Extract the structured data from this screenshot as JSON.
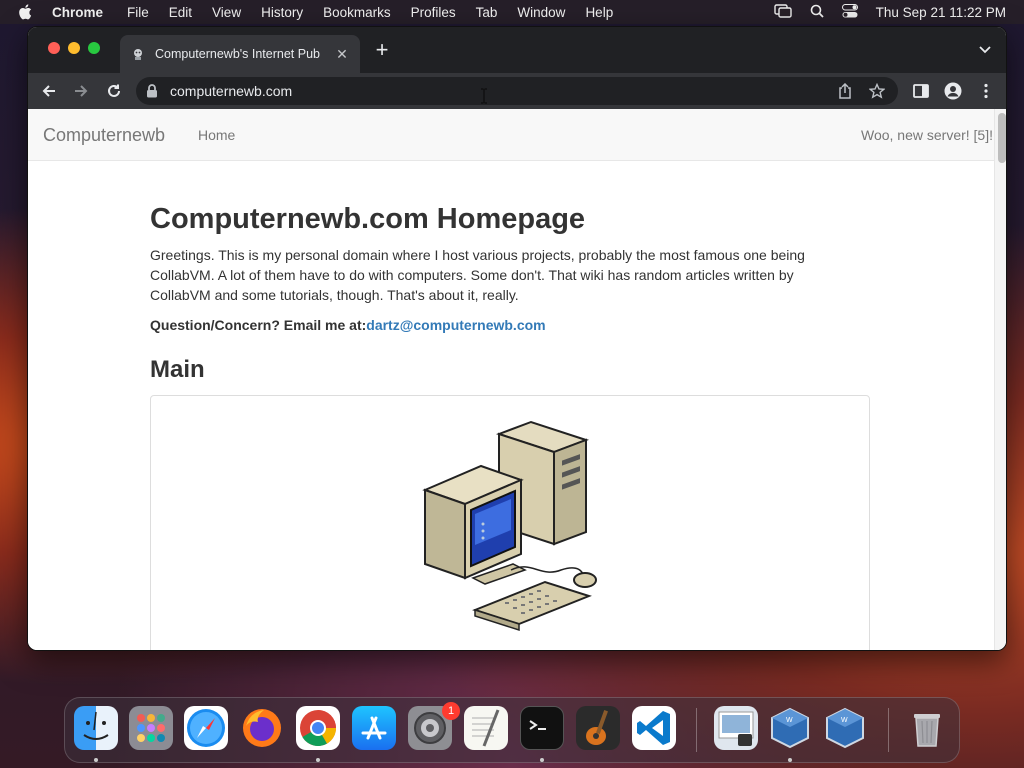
{
  "menubar": {
    "app_name": "Chrome",
    "items": [
      "File",
      "Edit",
      "View",
      "History",
      "Bookmarks",
      "Profiles",
      "Tab",
      "Window",
      "Help"
    ],
    "clock": "Thu Sep 21  11:22 PM"
  },
  "browser": {
    "tab_title": "Computernewb's Internet Pub",
    "url": "computernewb.com"
  },
  "site": {
    "brand": "Computernewb",
    "nav_home": "Home",
    "nav_right": "Woo, new server! [5]!",
    "heading": "Computernewb.com Homepage",
    "intro": "Greetings. This is my personal domain where I host various projects, probably the most famous one being CollabVM. A lot of them have to do with computers. Some don't. That wiki has random articles written by CollabVM and some tutorials, though. That's about it, really.",
    "contact_label": "Question/Concern? Email me at:",
    "contact_email": "dartz@computernewb.com",
    "section_title": "Main"
  },
  "dock": {
    "apps": [
      "finder",
      "launchpad",
      "safari",
      "firefox",
      "chrome",
      "app-store",
      "system-settings",
      "textedit",
      "terminal",
      "garageband",
      "vscode",
      "preview",
      "virtualbox-vm-1",
      "virtualbox-vm-2",
      "trash"
    ],
    "settings_badge": "1"
  }
}
